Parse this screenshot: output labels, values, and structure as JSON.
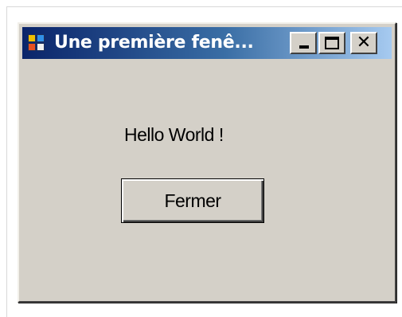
{
  "window": {
    "title": "Une première fenê...",
    "controls": {
      "close_glyph": "✕"
    }
  },
  "content": {
    "label_text": "Hello World !",
    "button_label": "Fermer"
  },
  "colors": {
    "titlebar_start": "#0a246a",
    "titlebar_end": "#a6caf0",
    "window_face": "#d4d0c8"
  },
  "icons": {
    "app_icon": "application-window-icon",
    "minimize": "minimize-icon",
    "maximize": "maximize-icon",
    "close": "close-icon"
  }
}
